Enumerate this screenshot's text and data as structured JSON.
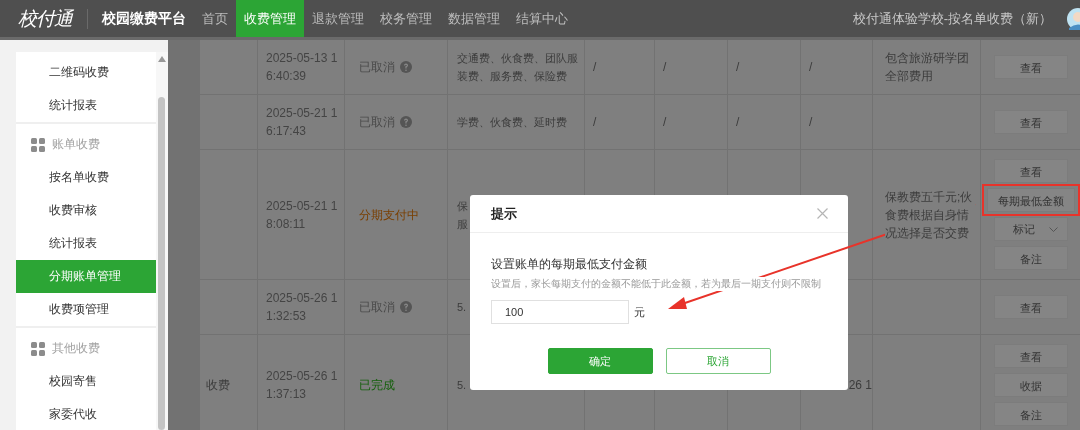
{
  "header": {
    "logo": "校付通",
    "platform": "校园缴费平台",
    "school": "校付通体验学校-按名单收费（新）",
    "nav": [
      {
        "label": "首页",
        "selected": false
      },
      {
        "label": "收费管理",
        "selected": true
      },
      {
        "label": "退款管理",
        "selected": false
      },
      {
        "label": "校务管理",
        "selected": false
      },
      {
        "label": "数据管理",
        "selected": false
      },
      {
        "label": "结算中心",
        "selected": false
      }
    ]
  },
  "sidebar": {
    "sections": [
      {
        "items": [
          {
            "label": "二维码收费",
            "selected": false
          },
          {
            "label": "统计报表",
            "selected": false
          }
        ]
      },
      {
        "title": "账单收费",
        "items": [
          {
            "label": "按名单收费",
            "selected": false
          },
          {
            "label": "收费审核",
            "selected": false
          },
          {
            "label": "统计报表",
            "selected": false
          },
          {
            "label": "分期账单管理",
            "selected": true
          },
          {
            "label": "收费项管理",
            "selected": false
          }
        ]
      },
      {
        "title": "其他收费",
        "items": [
          {
            "label": "校园寄售",
            "selected": false
          },
          {
            "label": "家委代收",
            "selected": false
          }
        ]
      }
    ]
  },
  "table": {
    "rows": [
      {
        "time": "2025-05-13 16:40:39",
        "status": "已取消",
        "color": "#4a4a4a",
        "help": true,
        "items": "交通费、伙食费、团队服装费、服务费、保险费",
        "column_5": "/",
        "column_6": "/",
        "column_7": "/",
        "column_8": "/",
        "remark": "包含旅游研学团全部费用",
        "actions": [
          {
            "label": "查看",
            "kind": "button",
            "highlighted": false
          }
        ]
      },
      {
        "time": "2025-05-21 16:17:43",
        "status": "已取消",
        "color": "#4a4a4a",
        "help": true,
        "items": "学费、伙食费、延时费",
        "column_5": "/",
        "column_6": "/",
        "column_7": "/",
        "column_8": "/",
        "actions": [
          {
            "label": "查看",
            "kind": "button",
            "highlighted": false
          }
        ]
      },
      {
        "time": "2025-05-21 18:08:11",
        "status": "分期支付中",
        "color": "#7a3f00",
        "help": false,
        "items": [
          "保",
          "服"
        ],
        "remark": "保教费五千元;伙食费根据自身情况选择是否交费",
        "actions": [
          {
            "label": "查看",
            "kind": "button",
            "highlighted": false
          },
          {
            "label": "每期最低金额",
            "kind": "button",
            "highlighted": true
          },
          {
            "label": "标记",
            "kind": "dropdown",
            "highlighted": false
          },
          {
            "label": "备注",
            "kind": "button",
            "highlighted": false
          }
        ]
      },
      {
        "time": "2025-05-26 11:32:53",
        "status": "已取消",
        "color": "#4a4a4a",
        "help": true,
        "items": "5.",
        "actions": [
          {
            "label": "查看",
            "kind": "button",
            "highlighted": false
          }
        ]
      },
      {
        "column_1": "收费",
        "time": "2025-05-26 11:37:13",
        "status": "已完成",
        "color": "#15600c",
        "help": false,
        "items": "5.",
        "column_8": "26 1",
        "actions": [
          {
            "label": "查看",
            "kind": "button",
            "highlighted": false
          },
          {
            "label": "收据",
            "kind": "button",
            "highlighted": false
          },
          {
            "label": "备注",
            "kind": "button",
            "highlighted": false
          }
        ]
      }
    ]
  },
  "dialog": {
    "title": "提示",
    "label": "设置账单的每期最低支付金额",
    "hint": "设置后，家长每期支付的金额不能低于此金额，若为最后一期支付则不限制",
    "value": "100",
    "unit": "元",
    "confirm": "确定",
    "cancel": "取消"
  }
}
